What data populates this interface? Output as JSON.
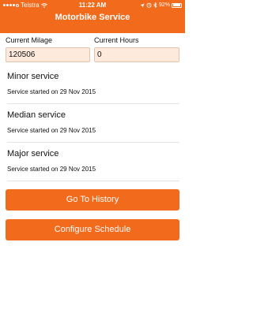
{
  "status_bar": {
    "carrier": "Telstra",
    "time": "11:22 AM",
    "battery": "92%",
    "battery_level": 0.92
  },
  "header": {
    "title": "Motorbike Service"
  },
  "fields": {
    "milage_label": "Current Milage",
    "milage_value": "120506",
    "hours_label": "Current Hours",
    "hours_value": "0"
  },
  "services": [
    {
      "title": "Minor service",
      "status": "Service started on 29 Nov 2015"
    },
    {
      "title": "Median service",
      "status": "Service started on 29 Nov 2015"
    },
    {
      "title": "Major service",
      "status": "Service started on 29 Nov 2015"
    }
  ],
  "buttons": {
    "history": "Go To History",
    "configure": "Configure Schedule"
  },
  "colors": {
    "accent": "#f26a1b",
    "input_bg": "#fdeadd"
  }
}
